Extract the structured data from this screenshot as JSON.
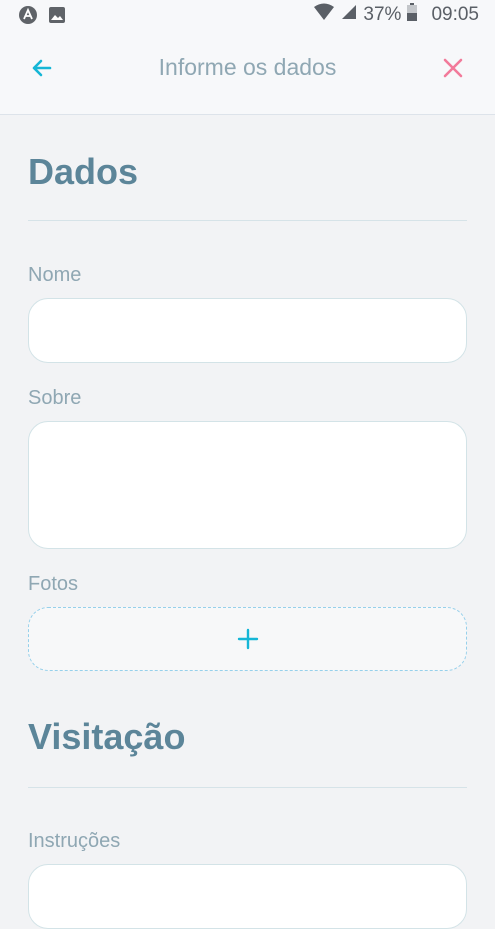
{
  "status_bar": {
    "battery": "37%",
    "time": "09:05"
  },
  "app_bar": {
    "title": "Informe os dados"
  },
  "sections": {
    "dados": {
      "title": "Dados",
      "fields": {
        "nome": {
          "label": "Nome",
          "value": ""
        },
        "sobre": {
          "label": "Sobre",
          "value": ""
        },
        "fotos": {
          "label": "Fotos"
        }
      }
    },
    "visitacao": {
      "title": "Visitação",
      "fields": {
        "instrucoes": {
          "label": "Instruções",
          "value": ""
        }
      }
    }
  },
  "colors": {
    "accent": "#15b6d6",
    "close": "#f27a9a",
    "heading": "#5c8599",
    "label": "#8fa7b3"
  }
}
